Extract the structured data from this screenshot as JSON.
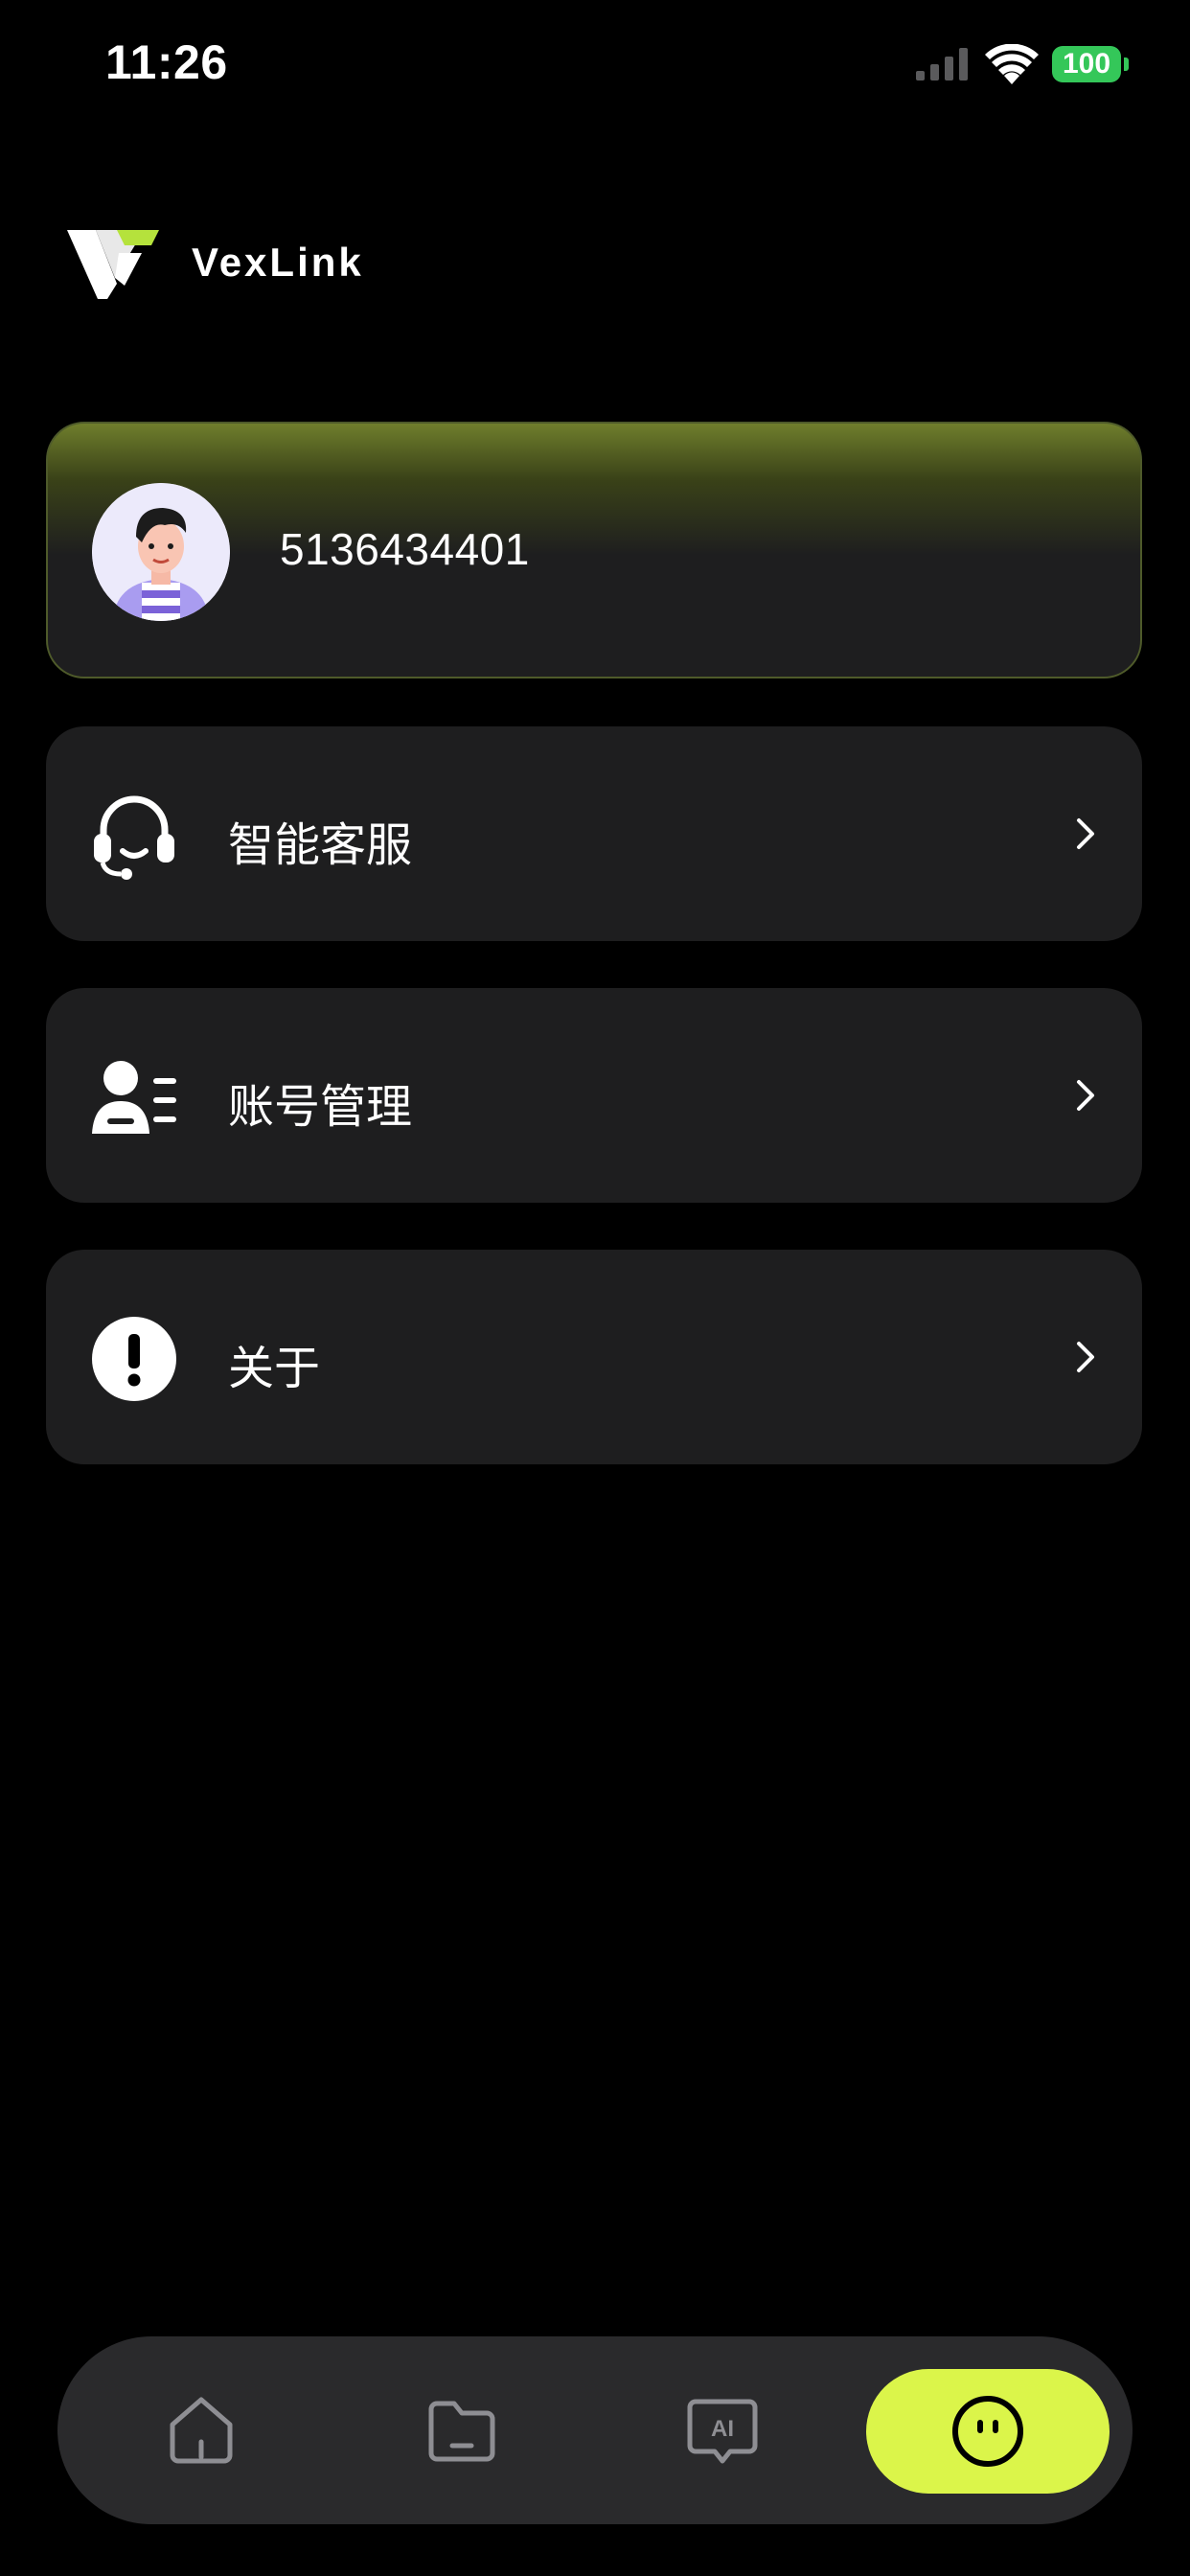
{
  "status_bar": {
    "time": "11:26",
    "battery": "100",
    "icons": [
      "cellular-signal-icon",
      "wifi-icon",
      "battery-icon"
    ]
  },
  "header": {
    "app_name": "VexLink",
    "logo_icon": "vexlink-logo-icon"
  },
  "profile": {
    "user_id": "5136434401",
    "avatar_icon": "user-avatar"
  },
  "menu": {
    "items": [
      {
        "label": "智能客服",
        "icon": "headset-icon"
      },
      {
        "label": "账号管理",
        "icon": "account-manage-icon"
      },
      {
        "label": "关于",
        "icon": "info-exclamation-icon"
      }
    ]
  },
  "tab_bar": {
    "tabs": [
      {
        "name": "home",
        "icon": "home-icon",
        "active": false
      },
      {
        "name": "files",
        "icon": "folder-icon",
        "active": false
      },
      {
        "name": "ai-chat",
        "icon": "ai-chat-icon",
        "active": false
      },
      {
        "name": "profile",
        "icon": "face-icon",
        "active": true
      }
    ]
  },
  "colors": {
    "background": "#000000",
    "card": "#1e1e1f",
    "accent": "#dbf54a",
    "card_gradient_top": "#6f7e2c",
    "battery": "#34c759"
  }
}
